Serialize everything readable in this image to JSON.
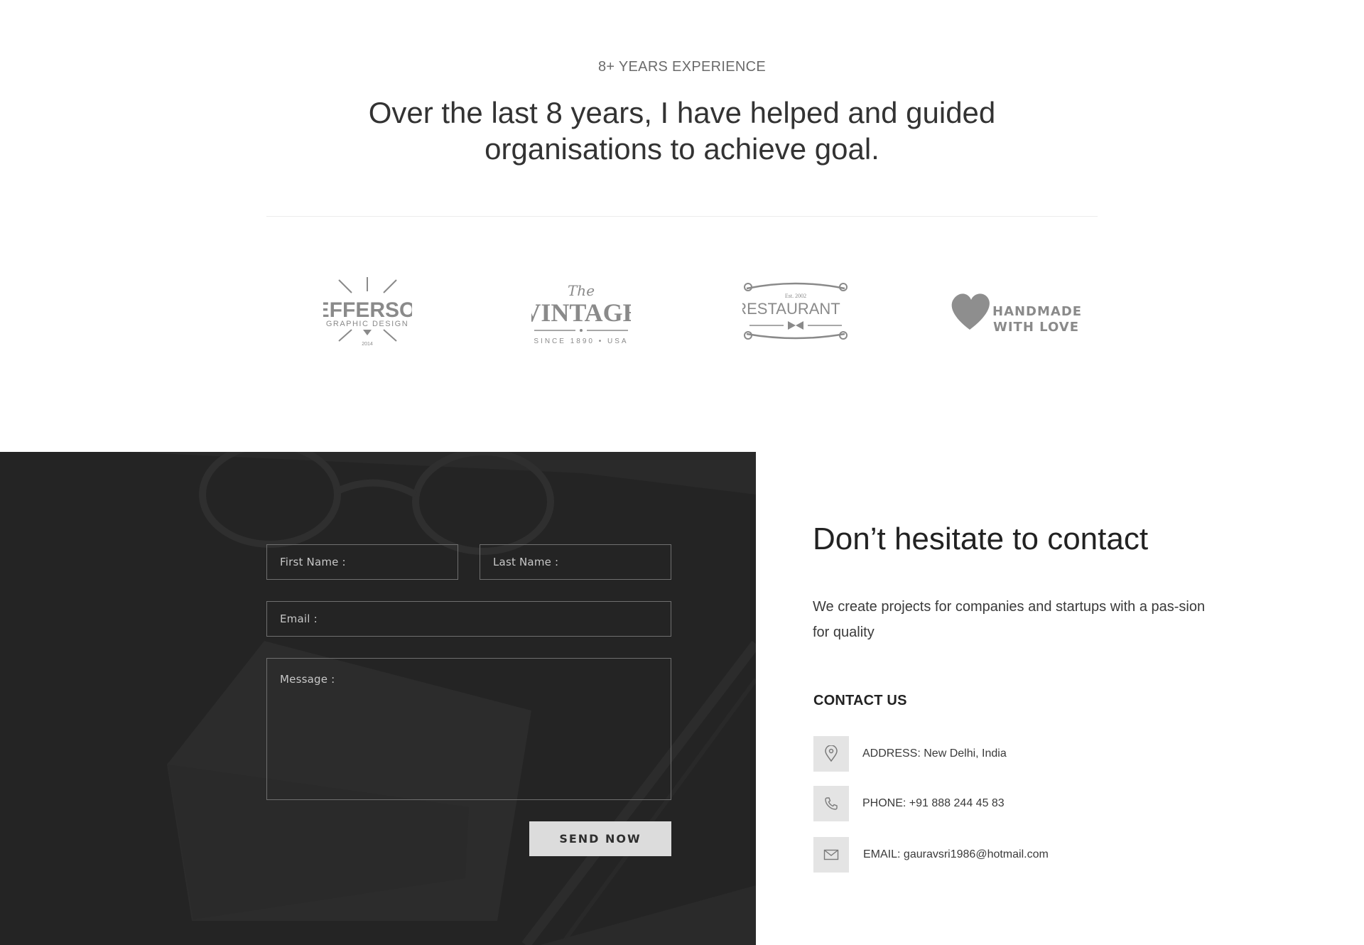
{
  "experience": {
    "label": "8+ YEARS EXPERIENCE",
    "heading": "Over the last 8 years, I have helped and guided organisations to achieve goal."
  },
  "logos": [
    {
      "name": "JEFFERSON",
      "sub": "GRAPHIC DESIGN",
      "extra": "2014"
    },
    {
      "name": "VINTAGE",
      "prefix": "The",
      "sub": "SINCE 1890 • USA"
    },
    {
      "name": "RESTAURANT",
      "prefix": "Est. 2002"
    },
    {
      "name": "HANDMADE",
      "sub": "WITH LOVE"
    }
  ],
  "form": {
    "first_name": "First Name :",
    "last_name": "Last Name :",
    "email": "Email :",
    "message": "Message :",
    "submit": "SEND NOW"
  },
  "contact": {
    "title": "Don’t hesitate to contact",
    "description": "We create projects for companies and startups with a pas-sion for quality",
    "subtitle": "CONTACT US",
    "address_label": "ADDRESS:",
    "address_value": "New Delhi, India",
    "phone_label": "PHONE:",
    "phone_value": "+91 888 244 45 83",
    "email_label": "EMAIL:",
    "email_value": "gauravsri1986@hotmail.com"
  },
  "icons": {
    "address": "map-pin-icon",
    "phone": "phone-icon",
    "email": "envelope-icon"
  }
}
